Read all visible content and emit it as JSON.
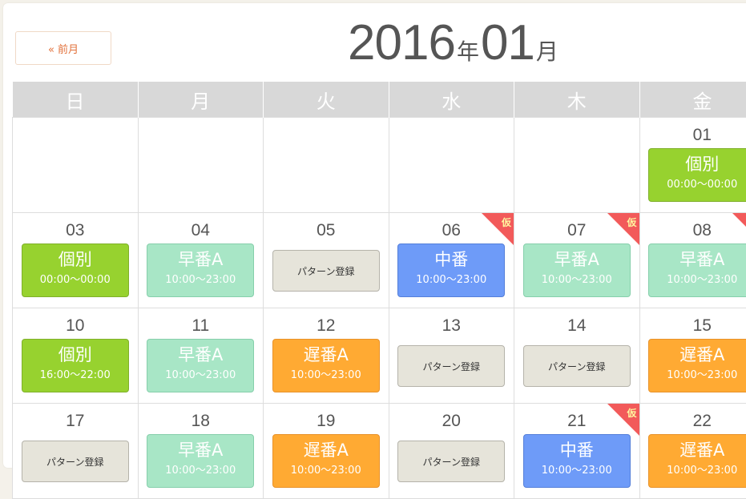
{
  "nav": {
    "prev_label": "« 前月"
  },
  "title": {
    "year": "2016",
    "year_unit": "年",
    "month": "01",
    "month_unit": "月"
  },
  "weekdays": [
    "日",
    "月",
    "火",
    "水",
    "木",
    "金"
  ],
  "provisional_label": "仮",
  "colors": {
    "kobetsu": "#97d22f",
    "hayaban": "#a8e6c6",
    "nakaban": "#6e9bf8",
    "osoban": "#ffaa33",
    "pattern": "#e6e4da",
    "provisional": "#f25a5a",
    "prev_button_text": "#e2703a"
  },
  "weeks": [
    [
      {},
      {},
      {},
      {},
      {},
      {
        "day": "01",
        "shift": {
          "type": "kobetsu",
          "name": "個別",
          "time": "00:00〜00:00"
        }
      }
    ],
    [
      {
        "day": "03",
        "shift": {
          "type": "kobetsu",
          "name": "個別",
          "time": "00:00〜00:00"
        }
      },
      {
        "day": "04",
        "shift": {
          "type": "hayaban",
          "name": "早番A",
          "time": "10:00〜23:00"
        }
      },
      {
        "day": "05",
        "shift": {
          "type": "pattern",
          "name": "パターン登録"
        }
      },
      {
        "day": "06",
        "provisional": true,
        "shift": {
          "type": "nakaban",
          "name": "中番",
          "time": "10:00〜23:00"
        }
      },
      {
        "day": "07",
        "provisional": true,
        "shift": {
          "type": "hayaban",
          "name": "早番A",
          "time": "10:00〜23:00"
        }
      },
      {
        "day": "08",
        "provisional": true,
        "shift": {
          "type": "hayaban",
          "name": "早番A",
          "time": "10:00〜23:00"
        }
      }
    ],
    [
      {
        "day": "10",
        "shift": {
          "type": "kobetsu",
          "name": "個別",
          "time": "16:00〜22:00"
        }
      },
      {
        "day": "11",
        "shift": {
          "type": "hayaban",
          "name": "早番A",
          "time": "10:00〜23:00"
        }
      },
      {
        "day": "12",
        "shift": {
          "type": "osoban",
          "name": "遅番A",
          "time": "10:00〜23:00"
        }
      },
      {
        "day": "13",
        "shift": {
          "type": "pattern",
          "name": "パターン登録"
        }
      },
      {
        "day": "14",
        "shift": {
          "type": "pattern",
          "name": "パターン登録"
        }
      },
      {
        "day": "15",
        "shift": {
          "type": "osoban",
          "name": "遅番A",
          "time": "10:00〜23:00"
        }
      }
    ],
    [
      {
        "day": "17",
        "shift": {
          "type": "pattern",
          "name": "パターン登録"
        }
      },
      {
        "day": "18",
        "shift": {
          "type": "hayaban",
          "name": "早番A",
          "time": "10:00〜23:00"
        }
      },
      {
        "day": "19",
        "shift": {
          "type": "osoban",
          "name": "遅番A",
          "time": "10:00〜23:00"
        }
      },
      {
        "day": "20",
        "shift": {
          "type": "pattern",
          "name": "パターン登録"
        }
      },
      {
        "day": "21",
        "provisional": true,
        "shift": {
          "type": "nakaban",
          "name": "中番",
          "time": "10:00〜23:00"
        }
      },
      {
        "day": "22",
        "shift": {
          "type": "osoban",
          "name": "遅番A",
          "time": "10:00〜23:00"
        }
      }
    ]
  ]
}
